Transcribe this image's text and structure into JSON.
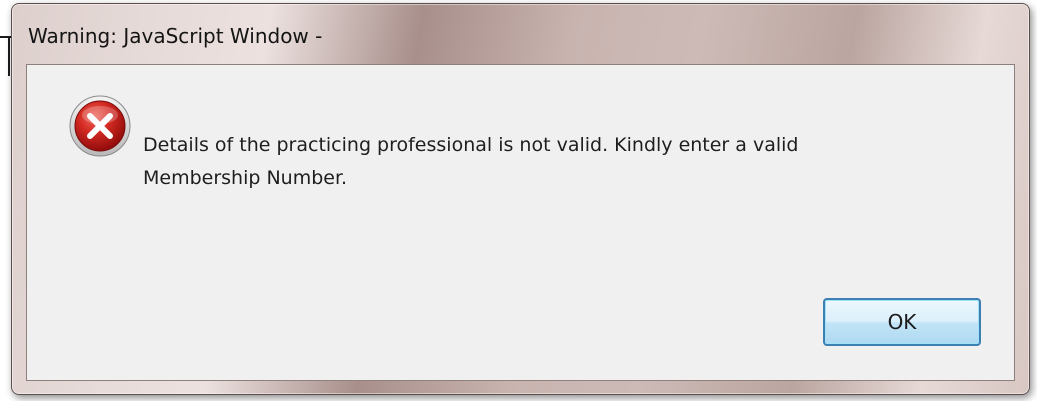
{
  "window": {
    "title": "Warning: JavaScript Window -"
  },
  "dialog": {
    "icon": "error-icon",
    "message_line1": "Details of the practicing professional is not valid. Kindly enter a valid",
    "message_line2": "Membership Number.",
    "ok_label": "OK"
  },
  "colors": {
    "error_red": "#c8141b",
    "button_border": "#3c7fb1",
    "client_bg": "#f0f0f0"
  }
}
